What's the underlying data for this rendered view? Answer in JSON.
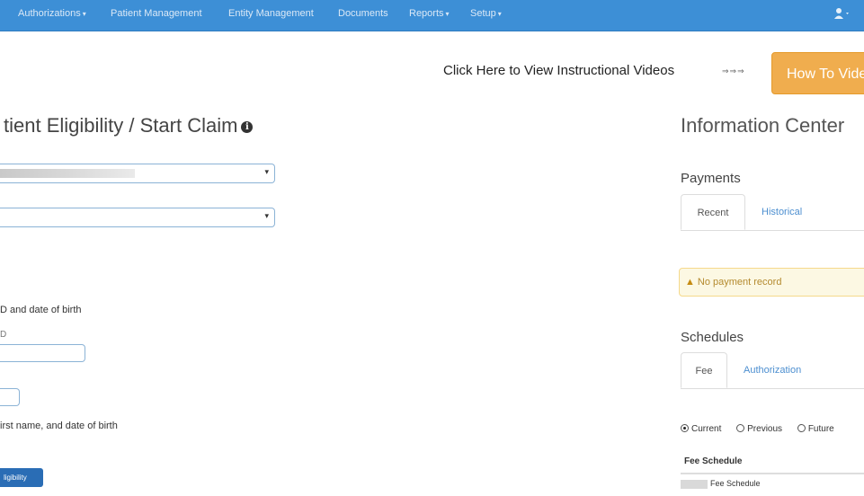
{
  "nav": {
    "items": [
      {
        "label": "Authorizations",
        "dropdown": true
      },
      {
        "label": "Patient Management",
        "dropdown": false
      },
      {
        "label": "Entity Management",
        "dropdown": false
      },
      {
        "label": "Documents",
        "dropdown": false
      },
      {
        "label": "Reports",
        "dropdown": true
      },
      {
        "label": "Setup",
        "dropdown": true
      }
    ],
    "user_icon": "user-icon"
  },
  "video": {
    "text": "Click Here to View Instructional Videos",
    "arrows": "⇒⇒⇒",
    "button_label": "How To Videos"
  },
  "main": {
    "title": "tient Eligibility / Start Claim",
    "label_id_dob": "D and date of birth",
    "label_id": "D",
    "label_name_dob": "irst name, and date of birth",
    "eligibility_button": "ligibility"
  },
  "info_center": {
    "title": "Information Center",
    "payments": {
      "title": "Payments",
      "tabs": [
        "Recent",
        "Historical"
      ],
      "alert": "No payment record"
    },
    "schedules": {
      "title": "Schedules",
      "tabs": [
        "Fee",
        "Authorization"
      ],
      "radios": [
        {
          "label": "Current",
          "checked": true
        },
        {
          "label": "Previous",
          "checked": false
        },
        {
          "label": "Future",
          "checked": false
        }
      ],
      "table_header": "Fee Schedule",
      "row_text": "Fee Schedule"
    }
  },
  "colors": {
    "navbar": "#3d8fd6",
    "howto_button": "#f0ad4e",
    "primary_button": "#2a6db5",
    "link": "#4d8fd0",
    "warning_bg": "#fcf8e3"
  }
}
